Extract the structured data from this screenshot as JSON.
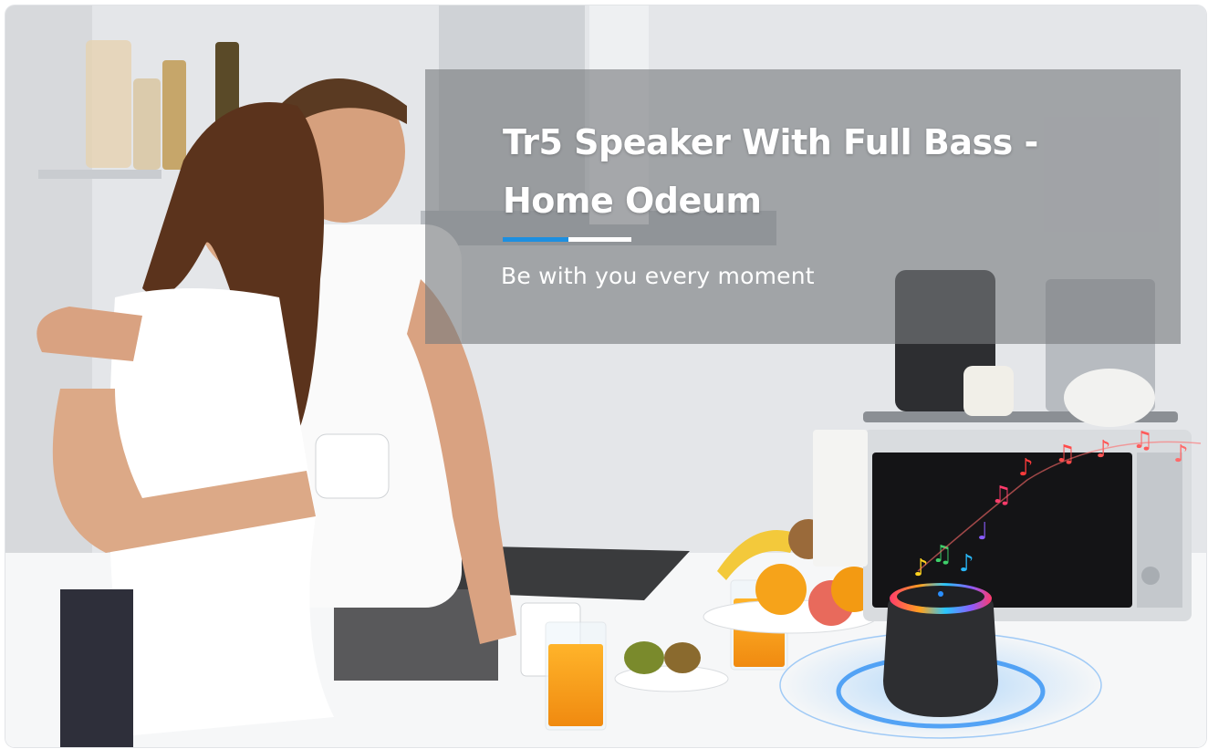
{
  "banner": {
    "headline_line1": "Tr5 Speaker With Full Bass -",
    "headline_line2": "Home Odeum",
    "subtitle": "Be with you every moment"
  },
  "colors": {
    "accent": "#1d8fe0",
    "overlay": "#787a7e",
    "text": "#ffffff"
  }
}
